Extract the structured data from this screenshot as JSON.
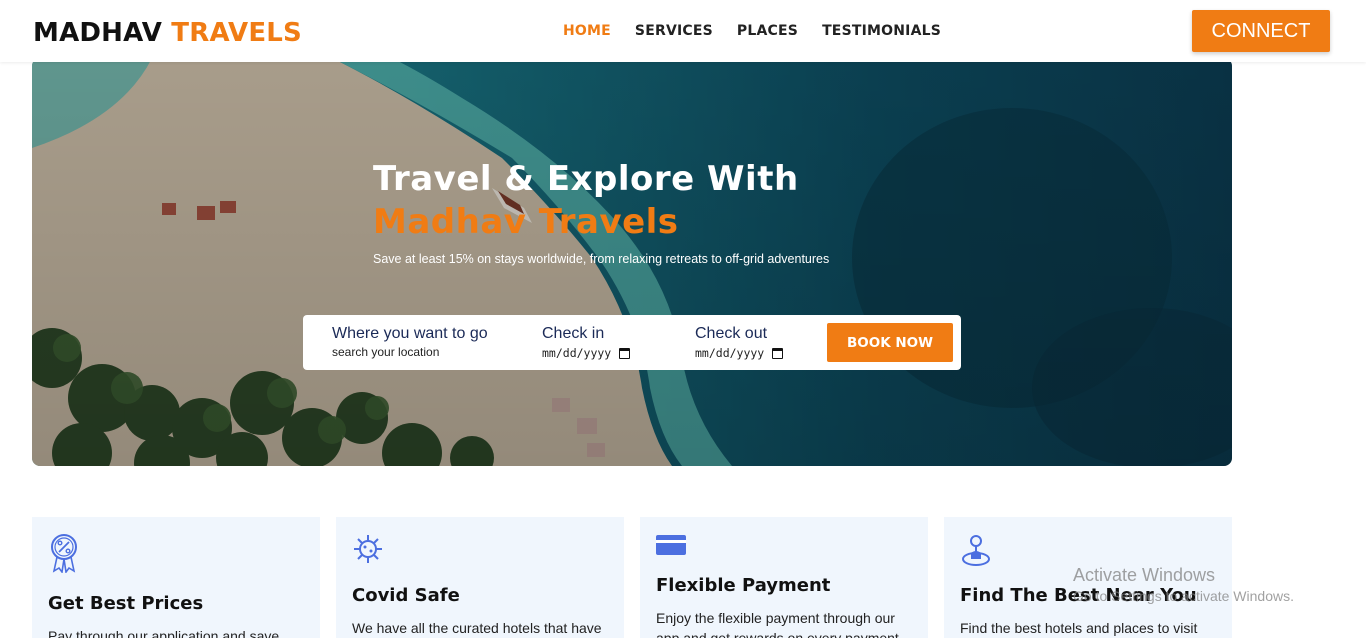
{
  "brand": {
    "part1": "MADHAV",
    "part2": "TRAVELS"
  },
  "nav": {
    "items": [
      {
        "label": "HOME",
        "active": true
      },
      {
        "label": "SERVICES",
        "active": false
      },
      {
        "label": "PLACES",
        "active": false
      },
      {
        "label": "TESTIMONIALS",
        "active": false
      }
    ],
    "connect_label": "CONNECT"
  },
  "hero": {
    "title_part1": "Travel & Explore With",
    "title_part2": "Madhav Travels",
    "subtitle": "Save at least 15% on stays worldwide, from relaxing retreats to off-grid adventures"
  },
  "search": {
    "where_label": "Where you want to go",
    "where_placeholder": "search your location",
    "checkin_label": "Check in",
    "checkin_value": "mm/dd/yyyy",
    "checkout_label": "Check out",
    "checkout_value": "mm/dd/yyyy",
    "book_label": "BOOK NOW"
  },
  "features": [
    {
      "icon": "discount-badge-icon",
      "title": "Get Best Prices",
      "desc": "Pay through our application and save"
    },
    {
      "icon": "virus-icon",
      "title": "Covid Safe",
      "desc": "We have all the curated hotels that have all the precaution for a covid safe"
    },
    {
      "icon": "credit-card-icon",
      "title": "Flexible Payment",
      "desc": "Enjoy the flexible payment through our app and get rewards on every payment."
    },
    {
      "icon": "location-pin-icon",
      "title": "Find The Best Near You",
      "desc": "Find the best hotels and places to visit near you in a single click."
    }
  ],
  "colors": {
    "accent": "#f07c14",
    "navy": "#1b2a57",
    "card_bg": "#f0f6fd",
    "icon_blue": "#4c6fe0"
  },
  "watermark": {
    "title": "Activate Windows",
    "subtitle": "Go to Settings to activate Windows."
  }
}
